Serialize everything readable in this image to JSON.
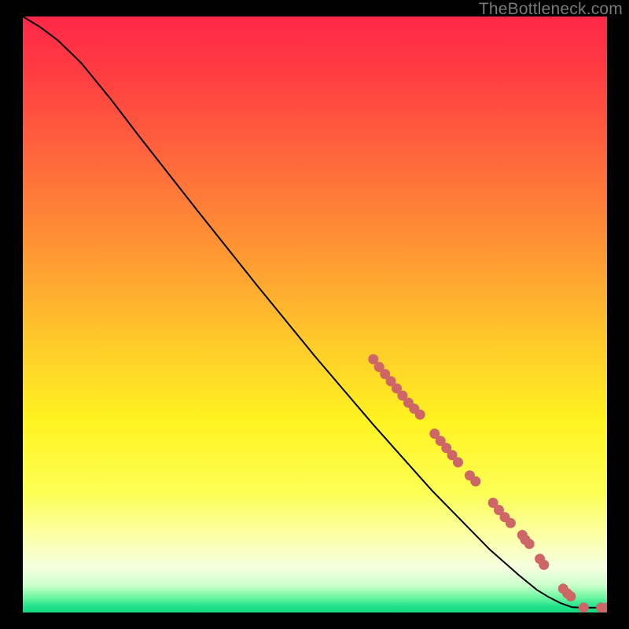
{
  "watermark": "TheBottleneck.com",
  "colors": {
    "background": "#000000",
    "curve": "#000000",
    "point": "#ce6567",
    "watermark": "#7a7a7a",
    "gradient_stops": [
      {
        "offset": 0.0,
        "color": "#ff2747"
      },
      {
        "offset": 0.1,
        "color": "#ff3e42"
      },
      {
        "offset": 0.25,
        "color": "#ff6b3b"
      },
      {
        "offset": 0.4,
        "color": "#ff9833"
      },
      {
        "offset": 0.55,
        "color": "#ffcb2a"
      },
      {
        "offset": 0.68,
        "color": "#fff321"
      },
      {
        "offset": 0.8,
        "color": "#fdff55"
      },
      {
        "offset": 0.88,
        "color": "#fbffb0"
      },
      {
        "offset": 0.925,
        "color": "#f6ffe0"
      },
      {
        "offset": 0.955,
        "color": "#c8ffca"
      },
      {
        "offset": 0.975,
        "color": "#6bf7a0"
      },
      {
        "offset": 0.99,
        "color": "#20e28a"
      },
      {
        "offset": 1.0,
        "color": "#12d980"
      }
    ]
  },
  "chart_data": {
    "type": "line",
    "title": "",
    "xlabel": "",
    "ylabel": "",
    "xlim": [
      0,
      100
    ],
    "ylim": [
      0,
      100
    ],
    "curve": [
      {
        "x": 0.0,
        "y": 100.0
      },
      {
        "x": 3.0,
        "y": 98.2
      },
      {
        "x": 6.0,
        "y": 96.0
      },
      {
        "x": 10.0,
        "y": 92.2
      },
      {
        "x": 15.0,
        "y": 86.2
      },
      {
        "x": 20.0,
        "y": 79.8
      },
      {
        "x": 30.0,
        "y": 67.3
      },
      {
        "x": 40.0,
        "y": 55.0
      },
      {
        "x": 50.0,
        "y": 43.0
      },
      {
        "x": 60.0,
        "y": 31.5
      },
      {
        "x": 70.0,
        "y": 20.5
      },
      {
        "x": 80.0,
        "y": 10.5
      },
      {
        "x": 85.0,
        "y": 6.2
      },
      {
        "x": 88.0,
        "y": 3.8
      },
      {
        "x": 90.0,
        "y": 2.6
      },
      {
        "x": 92.0,
        "y": 1.6
      },
      {
        "x": 94.0,
        "y": 0.9
      },
      {
        "x": 96.0,
        "y": 0.8
      },
      {
        "x": 98.0,
        "y": 0.8
      },
      {
        "x": 100.0,
        "y": 0.8
      }
    ],
    "series": [
      {
        "name": "marked-points",
        "points": [
          {
            "x": 60.0,
            "y": 42.5
          },
          {
            "x": 61.0,
            "y": 41.2
          },
          {
            "x": 62.0,
            "y": 40.0
          },
          {
            "x": 63.0,
            "y": 38.8
          },
          {
            "x": 64.0,
            "y": 37.6
          },
          {
            "x": 65.0,
            "y": 36.4
          },
          {
            "x": 66.0,
            "y": 35.2
          },
          {
            "x": 67.0,
            "y": 34.2
          },
          {
            "x": 68.0,
            "y": 33.2
          },
          {
            "x": 70.5,
            "y": 30.0
          },
          {
            "x": 71.5,
            "y": 28.8
          },
          {
            "x": 72.5,
            "y": 27.6
          },
          {
            "x": 73.5,
            "y": 26.4
          },
          {
            "x": 74.5,
            "y": 25.2
          },
          {
            "x": 76.5,
            "y": 23.0
          },
          {
            "x": 77.5,
            "y": 22.0
          },
          {
            "x": 80.5,
            "y": 18.4
          },
          {
            "x": 81.5,
            "y": 17.2
          },
          {
            "x": 82.5,
            "y": 16.0
          },
          {
            "x": 83.5,
            "y": 15.0
          },
          {
            "x": 85.5,
            "y": 13.0
          },
          {
            "x": 86.0,
            "y": 12.2
          },
          {
            "x": 86.7,
            "y": 11.5
          },
          {
            "x": 88.5,
            "y": 9.0
          },
          {
            "x": 89.2,
            "y": 8.0
          },
          {
            "x": 92.5,
            "y": 4.0
          },
          {
            "x": 93.2,
            "y": 3.2
          },
          {
            "x": 93.8,
            "y": 2.7
          },
          {
            "x": 96.0,
            "y": 0.8
          },
          {
            "x": 99.0,
            "y": 0.8
          },
          {
            "x": 100.0,
            "y": 0.8
          }
        ]
      }
    ]
  }
}
